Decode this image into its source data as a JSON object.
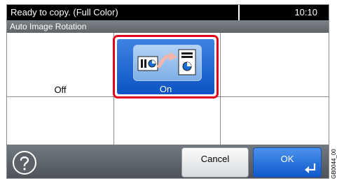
{
  "status": {
    "message": "Ready to copy. (Full Color)",
    "time": "10:10"
  },
  "header": {
    "title": "Auto Image Rotation"
  },
  "options": [
    {
      "label": "Off",
      "selected": false
    },
    {
      "label": "On",
      "selected": true
    }
  ],
  "footer": {
    "help_icon": "question-mark",
    "cancel_label": "Cancel",
    "ok_label": "OK",
    "ok_icon": "enter-arrow"
  },
  "figure_code": "GB0044_00",
  "colors": {
    "selection_border": "#e5001c",
    "selected_fill": "#0c53c4",
    "status_bar": "#000000"
  }
}
